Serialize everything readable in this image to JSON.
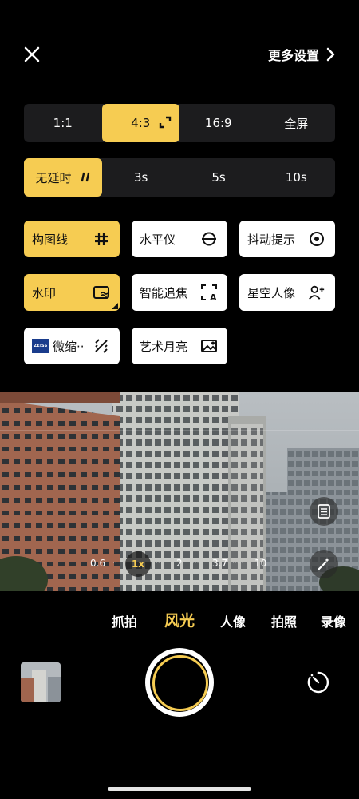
{
  "header": {
    "more_settings_label": "更多设置"
  },
  "aspect_ratio": {
    "options": [
      "1:1",
      "4:3",
      "16:9",
      "全屏"
    ],
    "selected": "4:3"
  },
  "delay": {
    "options": [
      "无延时",
      "3s",
      "5s",
      "10s"
    ],
    "selected": "无延时"
  },
  "toggles": [
    {
      "label": "构图线",
      "on": true,
      "icon": "grid-icon"
    },
    {
      "label": "水平仪",
      "on": false,
      "icon": "level-icon"
    },
    {
      "label": "抖动提示",
      "on": false,
      "icon": "shake-icon"
    },
    {
      "label": "水印",
      "on": true,
      "icon": "watermark-icon"
    },
    {
      "label": "智能追焦",
      "on": false,
      "icon": "focus-track-icon"
    },
    {
      "label": "星空人像",
      "on": false,
      "icon": "star-portrait-icon"
    },
    {
      "label": "微缩··",
      "on": false,
      "icon": "tilt-shift-icon",
      "brand": "ZEISS"
    },
    {
      "label": "艺术月亮",
      "on": false,
      "icon": "moon-art-icon"
    }
  ],
  "zoom": {
    "levels": [
      "0.6",
      "1x",
      "2",
      "3.7",
      "10"
    ],
    "selected": "1x"
  },
  "modes": {
    "items": [
      "抓拍",
      "风光",
      "人像",
      "拍照",
      "录像"
    ],
    "selected": "风光"
  },
  "colors": {
    "accent": "#f6cc52",
    "panel": "#1c1c1e"
  }
}
